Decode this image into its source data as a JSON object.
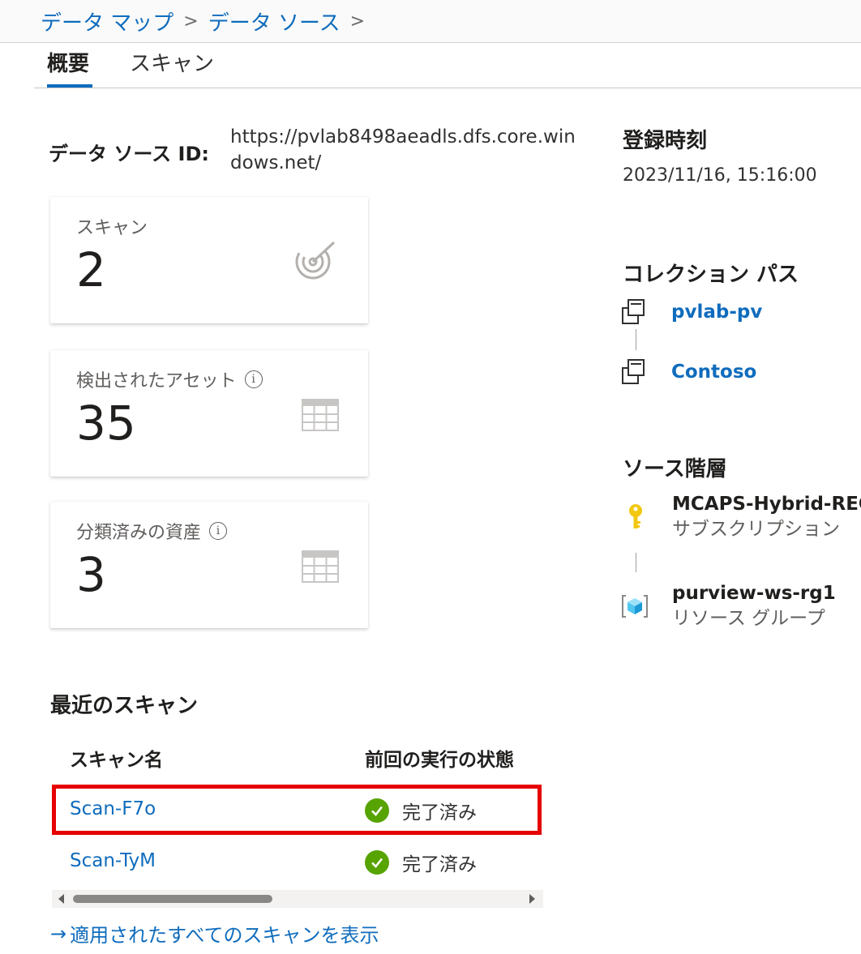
{
  "breadcrumb": {
    "items": [
      "データ マップ",
      "データ ソース"
    ],
    "separator": ">"
  },
  "tabs": [
    {
      "label": "概要",
      "selected": true
    },
    {
      "label": "スキャン",
      "selected": false
    }
  ],
  "data_source": {
    "id_label": "データ ソース ID:",
    "id_value": "https://pvlab8498aeadls.dfs.core.windows.net/"
  },
  "cards": {
    "scans": {
      "title": "スキャン",
      "value": "2",
      "icon": "radar-scan-icon"
    },
    "discovered_assets": {
      "title": "検出されたアセット",
      "value": "35",
      "icon": "table-icon",
      "info_icon": "info-icon"
    },
    "classified_assets": {
      "title": "分類済みの資産",
      "value": "3",
      "icon": "table-icon",
      "info_icon": "info-icon"
    }
  },
  "registration": {
    "title": "登録時刻",
    "value": "2023/11/16, 15:16:00"
  },
  "collection_path": {
    "title": "コレクション パス",
    "items": [
      {
        "name": "pvlab-pv",
        "icon": "collection-icon"
      },
      {
        "name": "Contoso",
        "icon": "collection-icon"
      }
    ]
  },
  "source_hierarchy": {
    "title": "ソース階層",
    "items": [
      {
        "name": "MCAPS-Hybrid-REQ",
        "type": "サブスクリプション",
        "icon": "key-icon"
      },
      {
        "name": "purview-ws-rg1",
        "type": "リソース グループ",
        "icon": "resource-group-icon"
      }
    ]
  },
  "recent_scans": {
    "title": "最近のスキャン",
    "columns": [
      "スキャン名",
      "前回の実行の状態"
    ],
    "rows": [
      {
        "name": "Scan-F7o",
        "status": "完了済み",
        "highlighted": true
      },
      {
        "name": "Scan-TyM",
        "status": "完了済み",
        "highlighted": false
      }
    ],
    "view_all": "適用されたすべてのスキャンを表示",
    "view_all_arrow": "→"
  },
  "colors": {
    "accent": "#0f6cbd",
    "success": "#57a300",
    "highlight": "#e60000"
  }
}
